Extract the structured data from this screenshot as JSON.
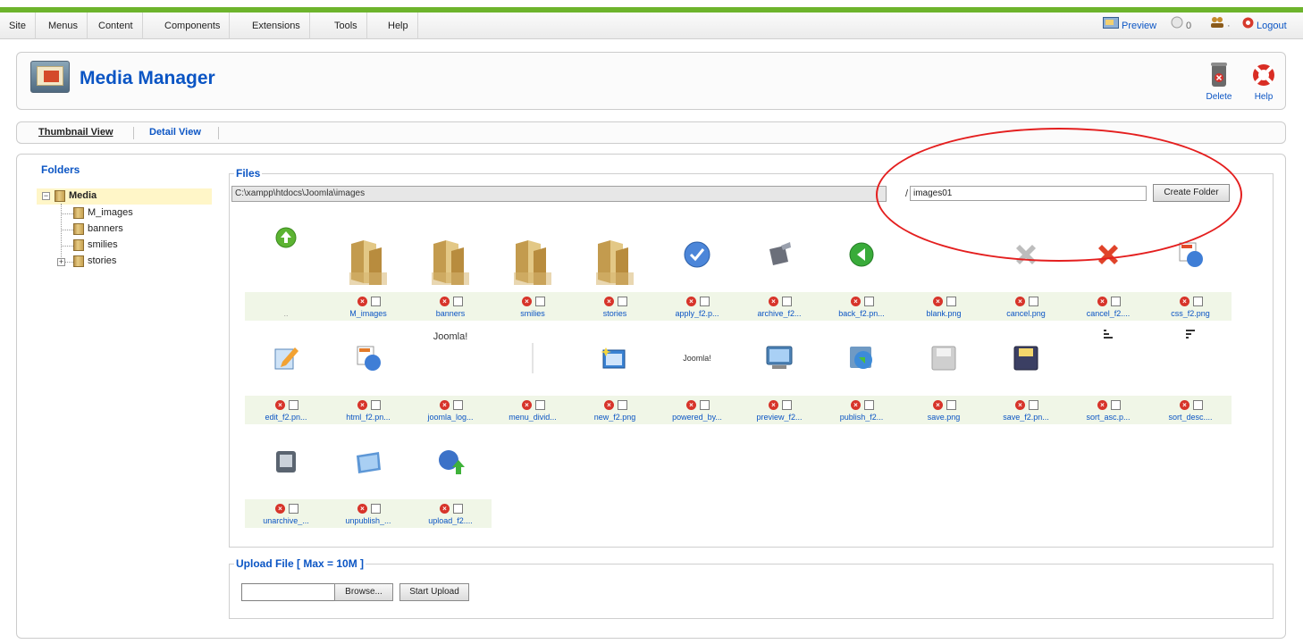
{
  "menu": {
    "items": [
      "Site",
      "Menus",
      "Content",
      "Components",
      "Extensions",
      "Tools",
      "Help"
    ]
  },
  "status": {
    "preview": "Preview",
    "messages": "0",
    "users_icon": "users-icon",
    "users_count": "·",
    "logout": "Logout"
  },
  "header": {
    "title": "Media Manager",
    "title_icon": "media-manager-icon",
    "delete_label": "Delete",
    "help_label": "Help"
  },
  "subnav": {
    "thumbnail": "Thumbnail View",
    "detail": "Detail View"
  },
  "folders": {
    "legend": "Folders",
    "root": "Media",
    "children": [
      "M_images",
      "banners",
      "smilies",
      "stories"
    ]
  },
  "files": {
    "legend": "Files",
    "path": "C:\\xampp\\htdocs\\Joomla\\images",
    "slash": "/",
    "new_folder_value": "images01",
    "create_folder_label": "Create Folder",
    "up_label": "..",
    "items": [
      {
        "name": "M_images",
        "icon": "folder-icon"
      },
      {
        "name": "banners",
        "icon": "folder-icon"
      },
      {
        "name": "smilies",
        "icon": "folder-icon"
      },
      {
        "name": "stories",
        "icon": "folder-icon"
      },
      {
        "name": "apply_f2.p...",
        "icon": "apply-icon"
      },
      {
        "name": "archive_f2...",
        "icon": "archive-icon"
      },
      {
        "name": "back_f2.pn...",
        "icon": "back-icon"
      },
      {
        "name": "blank.png",
        "icon": "blank-icon"
      },
      {
        "name": "cancel.png",
        "icon": "cancel-gray-icon"
      },
      {
        "name": "cancel_f2....",
        "icon": "cancel-icon"
      },
      {
        "name": "css_f2.png",
        "icon": "css-icon"
      },
      {
        "name": "edit_f2.pn...",
        "icon": "edit-icon"
      },
      {
        "name": "html_f2.pn...",
        "icon": "html-icon"
      },
      {
        "name": "joomla_log...",
        "icon": "joomla-logo-icon"
      },
      {
        "name": "menu_divid...",
        "icon": "menu-divider-icon"
      },
      {
        "name": "new_f2.png",
        "icon": "new-icon"
      },
      {
        "name": "powered_by...",
        "icon": "powered-by-icon"
      },
      {
        "name": "preview_f2...",
        "icon": "preview-icon"
      },
      {
        "name": "publish_f2...",
        "icon": "publish-icon"
      },
      {
        "name": "save.png",
        "icon": "save-gray-icon"
      },
      {
        "name": "save_f2.pn...",
        "icon": "save-icon"
      },
      {
        "name": "sort_asc.p...",
        "icon": "sort-asc-icon"
      },
      {
        "name": "sort_desc....",
        "icon": "sort-desc-icon"
      },
      {
        "name": "unarchive_...",
        "icon": "unarchive-icon"
      },
      {
        "name": "unpublish_...",
        "icon": "unpublish-icon"
      },
      {
        "name": "upload_f2....",
        "icon": "upload-icon"
      }
    ],
    "joomla_text": "Joomla!"
  },
  "upload": {
    "legend": "Upload File [ Max = 10M ]",
    "browse_label": "Browse...",
    "start_label": "Start Upload"
  },
  "colors": {
    "accent": "#0b55c4",
    "green_bar": "#6db42c",
    "annotation": "#e41f1f"
  }
}
